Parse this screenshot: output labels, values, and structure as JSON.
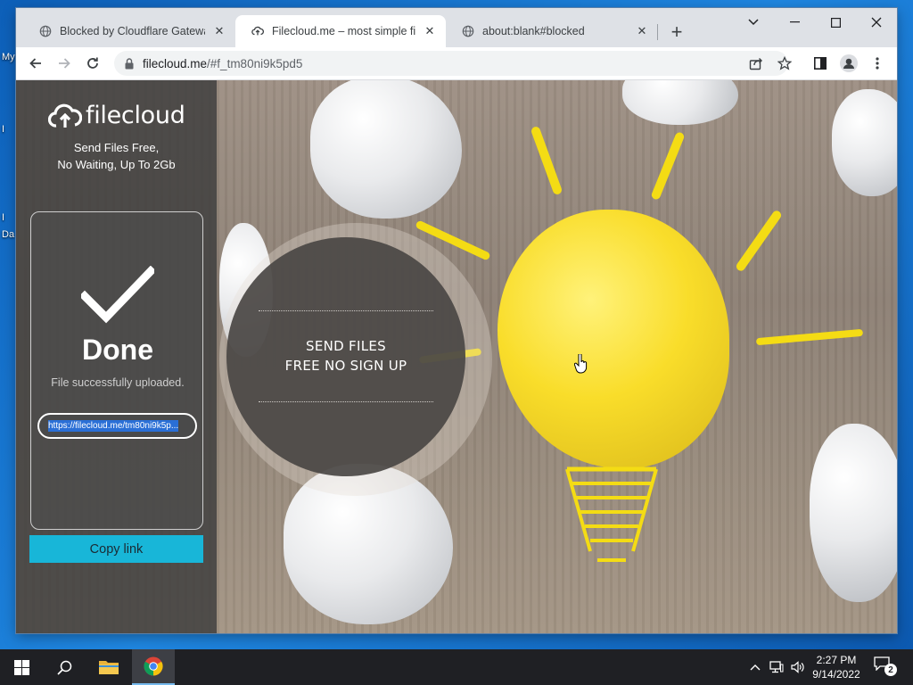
{
  "desktop": {
    "labels": [
      "My",
      "I",
      "I",
      "Da"
    ]
  },
  "browser": {
    "tabs": [
      {
        "title": "Blocked by Cloudflare Gateway",
        "icon": "globe-icon",
        "active": false
      },
      {
        "title": "Filecloud.me – most simple file s",
        "icon": "cloud-upload-icon",
        "active": true
      },
      {
        "title": "about:blank#blocked",
        "icon": "globe-icon",
        "active": false
      }
    ],
    "new_tab": "+",
    "address": {
      "host": "filecloud.me",
      "path": "/#f_tm80ni9k5pd5"
    }
  },
  "page": {
    "logo_text": "filecloud",
    "tagline_1": "Send Files Free,",
    "tagline_2": "No Waiting, Up To 2Gb",
    "status_title": "Done",
    "status_message": "File successfully uploaded.",
    "share_link": "https://filecloud.me/tm80ni9k5p...",
    "copy_button": "Copy link",
    "hero_line_1": "SEND FILES",
    "hero_line_2": "FREE NO SIGN UP"
  },
  "taskbar": {
    "time": "2:27 PM",
    "date": "9/14/2022",
    "notification_count": "2"
  },
  "colors": {
    "accent": "#18b6d8",
    "chrome_tabstrip": "#dee1e6",
    "taskbar": "#1f2024",
    "desktop": "#1b6fc8"
  }
}
